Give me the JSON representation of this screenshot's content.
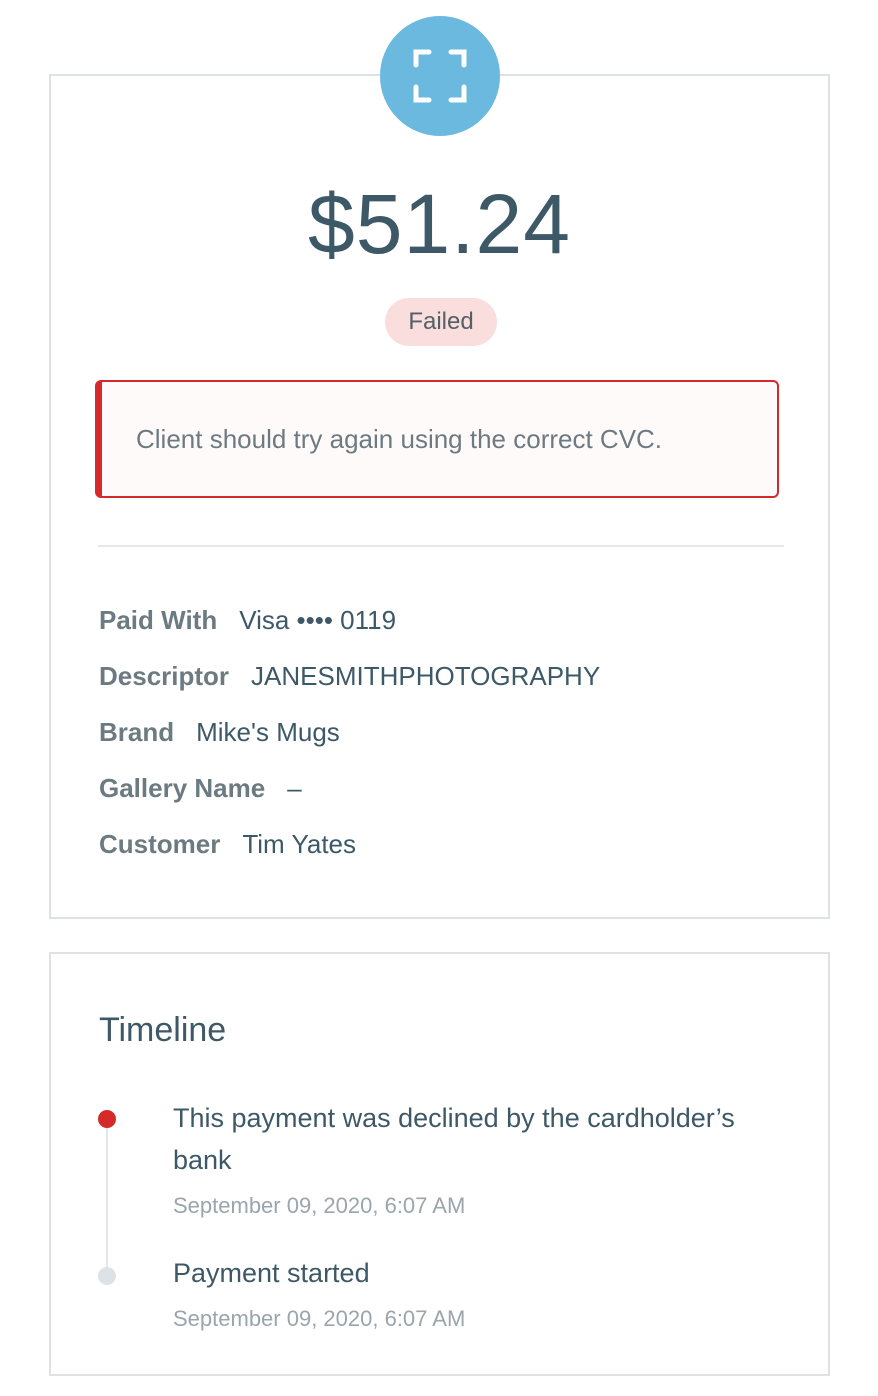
{
  "payment": {
    "expand_icon": "expand-icon",
    "amount": "$51.24",
    "status": "Failed",
    "alert_message": "Client should try again using the correct CVC.",
    "details": [
      {
        "label": "Paid With",
        "value": "Visa •••• 0119"
      },
      {
        "label": "Descriptor",
        "value": "JANESMITHPHOTOGRAPHY"
      },
      {
        "label": "Brand",
        "value": "Mike's Mugs"
      },
      {
        "label": "Gallery Name",
        "value": "–"
      },
      {
        "label": "Customer",
        "value": "Tim Yates"
      }
    ]
  },
  "timeline": {
    "title": "Timeline",
    "events": [
      {
        "text": "This payment was declined by the cardholder’s bank",
        "date": "September 09, 2020, 6:07 AM",
        "status_color": "#d42a2a"
      },
      {
        "text": "Payment started",
        "date": "September 09, 2020, 6:07 AM",
        "status_color": "#dde2e6"
      }
    ]
  },
  "colors": {
    "accent_blue": "#6cb9e0",
    "error_red": "#d42a2a",
    "failed_badge_bg": "#f9dedd",
    "text_primary": "#3d5867"
  }
}
